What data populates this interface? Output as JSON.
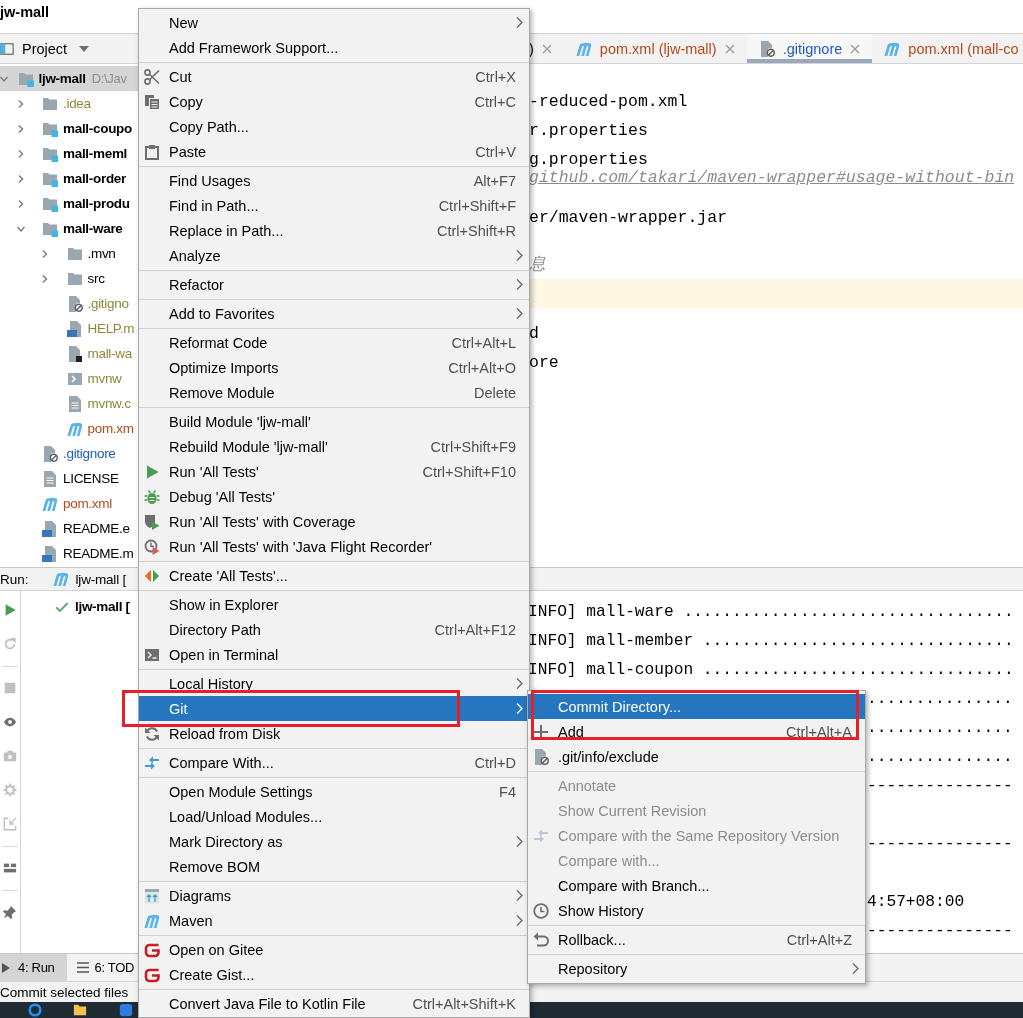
{
  "title_bar": {
    "title": "jw-mall"
  },
  "project_panel": {
    "title": "Project",
    "tree": [
      {
        "label": "ljw-mall",
        "path": "D:\\Jav",
        "kind": "module",
        "color": "#000000",
        "selected": true,
        "expanded": true,
        "children": [
          {
            "label": ".idea",
            "kind": "folder",
            "color": "#8c8a3a",
            "selected": false,
            "expanded": false
          },
          {
            "label": "mall-coupo",
            "kind": "module",
            "color": "#000000",
            "selected": false,
            "expanded": false
          },
          {
            "label": "mall-meml",
            "kind": "module",
            "color": "#000000",
            "selected": false,
            "expanded": false
          },
          {
            "label": "mall-order",
            "kind": "module",
            "color": "#000000",
            "selected": false,
            "expanded": false
          },
          {
            "label": "mall-produ",
            "kind": "module",
            "color": "#000000",
            "selected": false,
            "expanded": false
          },
          {
            "label": "mall-ware",
            "kind": "module",
            "color": "#000000",
            "selected": false,
            "expanded": true,
            "children": [
              {
                "label": ".mvn",
                "kind": "folder",
                "color": "#000000",
                "selected": false,
                "expanded": false
              },
              {
                "label": "src",
                "kind": "folder",
                "color": "#000000",
                "selected": false,
                "expanded": false
              },
              {
                "label": ".gitigno",
                "kind": "ignore",
                "color": "#8c8a3a",
                "selected": false
              },
              {
                "label": "HELP.m",
                "kind": "md",
                "color": "#8c8a3a",
                "selected": false
              },
              {
                "label": "mall-wa",
                "kind": "iml",
                "color": "#8c8a3a",
                "selected": false
              },
              {
                "label": "mvnw",
                "kind": "script",
                "color": "#8c8a3a",
                "selected": false
              },
              {
                "label": "mvnw.c",
                "kind": "text",
                "color": "#8c8a3a",
                "selected": false
              },
              {
                "label": "pom.xm",
                "kind": "maven",
                "color": "#b5491c",
                "selected": false
              }
            ]
          },
          {
            "label": ".gitignore",
            "kind": "ignore",
            "color": "#1d5bbf",
            "selected": false
          },
          {
            "label": "LICENSE",
            "kind": "text",
            "color": "#000000",
            "selected": false
          },
          {
            "label": "pom.xml",
            "kind": "maven",
            "color": "#b5491c",
            "selected": false
          },
          {
            "label": "README.e",
            "kind": "md",
            "color": "#000000",
            "selected": false
          },
          {
            "label": "README.m",
            "kind": "md",
            "color": "#000000",
            "selected": false
          }
        ]
      }
    ]
  },
  "editor": {
    "tabs": [
      {
        "label": ")",
        "kind": "plain",
        "selected": false
      },
      {
        "label": "pom.xml (ljw-mall)",
        "kind": "maven",
        "color": "#b5491c",
        "selected": false
      },
      {
        "label": ".gitignore",
        "kind": "ignore",
        "color": "#1d5bbf",
        "selected": true
      },
      {
        "label": "pom.xml (mall-co",
        "kind": "maven",
        "color": "#b5491c",
        "selected": false
      }
    ],
    "lines": [
      {
        "text": "-reduced-pom.xml",
        "kind": "code",
        "current": false
      },
      {
        "text": "r.properties",
        "kind": "code",
        "current": false
      },
      {
        "text": "g.properties",
        "kind": "code",
        "current": false
      },
      {
        "text": "github.com/takari/maven-wrapper#usage-without-bin",
        "kind": "link",
        "current": false
      },
      {
        "text": "er/maven-wrapper.jar",
        "kind": "code",
        "current": false
      },
      {
        "kind": "blank",
        "current": false
      },
      {
        "text": "息",
        "kind": "comment",
        "current": false
      },
      {
        "kind": "blank",
        "current": true
      },
      {
        "text": "d",
        "kind": "code",
        "current": false
      },
      {
        "text": "ore",
        "kind": "code",
        "current": false
      }
    ]
  },
  "run_panel": {
    "title": "Run:",
    "tab": {
      "label": "ljw-mall [",
      "kind": "maven"
    },
    "toolbar": [
      {
        "buttons": [
          {
            "kind": "run",
            "disabled": false
          },
          {
            "kind": "rerun",
            "disabled": true
          }
        ]
      },
      {
        "buttons": [
          {
            "kind": "stop",
            "disabled": true
          },
          {
            "kind": "eye",
            "disabled": false
          },
          {
            "kind": "camera",
            "disabled": true
          },
          {
            "kind": "export",
            "disabled": true
          },
          {
            "kind": "import",
            "disabled": true
          }
        ]
      },
      {
        "buttons": [
          {
            "kind": "layout",
            "disabled": false
          }
        ]
      },
      {
        "buttons": [
          {
            "kind": "pin",
            "disabled": false
          }
        ]
      }
    ],
    "tree": [
      {
        "label": "ljw-mall [",
        "passed": true
      }
    ],
    "console": [
      {
        "text": "INFO] mall-ware ..................................",
        "kind": "full"
      },
      {
        "text": "INFO] mall-member ................................",
        "kind": "full"
      },
      {
        "text": "INFO] mall-coupon ................................",
        "kind": "full"
      },
      {
        "text": "...............",
        "kind": "tail"
      },
      {
        "text": "...............",
        "kind": "tail"
      },
      {
        "text": "...............",
        "kind": "tail"
      },
      {
        "text": "---------------",
        "kind": "tail"
      },
      {
        "kind": "blank"
      },
      {
        "text": "---------------",
        "kind": "tail"
      },
      {
        "kind": "blank"
      },
      {
        "text": "4:57+08:00",
        "kind": "tail"
      },
      {
        "text": "---------------",
        "kind": "tail"
      }
    ]
  },
  "tool_window_bar": {
    "tabs": [
      {
        "label": "4: Run",
        "kind": "run",
        "selected": true
      },
      {
        "label": "6: TOD",
        "kind": "todo",
        "selected": false
      }
    ]
  },
  "status_bar": {
    "text": "Commit selected files"
  },
  "context_menu": {
    "groups": [
      {
        "items": [
          {
            "label": "New",
            "kind": "plain",
            "submenu": true,
            "selected": false,
            "boxed": false
          },
          {
            "label": "Add Framework Support...",
            "kind": "plain",
            "submenu": false,
            "selected": false,
            "boxed": false
          }
        ]
      },
      {
        "items": [
          {
            "label": "Cut",
            "shortcut": "Ctrl+X",
            "kind": "cut",
            "submenu": false,
            "selected": false,
            "boxed": false
          },
          {
            "label": "Copy",
            "shortcut": "Ctrl+C",
            "kind": "copy",
            "submenu": false,
            "selected": false,
            "boxed": false
          },
          {
            "label": "Copy Path...",
            "kind": "plain",
            "submenu": false,
            "selected": false,
            "boxed": false
          },
          {
            "label": "Paste",
            "shortcut": "Ctrl+V",
            "kind": "paste",
            "submenu": false,
            "selected": false,
            "boxed": false
          }
        ]
      },
      {
        "items": [
          {
            "label": "Find Usages",
            "shortcut": "Alt+F7",
            "kind": "plain",
            "submenu": false,
            "selected": false,
            "boxed": false
          },
          {
            "label": "Find in Path...",
            "shortcut": "Ctrl+Shift+F",
            "kind": "plain",
            "submenu": false,
            "selected": false,
            "boxed": false
          },
          {
            "label": "Replace in Path...",
            "shortcut": "Ctrl+Shift+R",
            "kind": "plain",
            "submenu": false,
            "selected": false,
            "boxed": false
          },
          {
            "label": "Analyze",
            "kind": "plain",
            "submenu": true,
            "selected": false,
            "boxed": false
          }
        ]
      },
      {
        "items": [
          {
            "label": "Refactor",
            "kind": "plain",
            "submenu": true,
            "selected": false,
            "boxed": false
          }
        ]
      },
      {
        "items": [
          {
            "label": "Add to Favorites",
            "kind": "plain",
            "submenu": true,
            "selected": false,
            "boxed": false
          }
        ]
      },
      {
        "items": [
          {
            "label": "Reformat Code",
            "shortcut": "Ctrl+Alt+L",
            "kind": "plain",
            "submenu": false,
            "selected": false,
            "boxed": false
          },
          {
            "label": "Optimize Imports",
            "shortcut": "Ctrl+Alt+O",
            "kind": "plain",
            "submenu": false,
            "selected": false,
            "boxed": false
          },
          {
            "label": "Remove Module",
            "shortcut": "Delete",
            "kind": "plain",
            "submenu": false,
            "selected": false,
            "boxed": false
          }
        ]
      },
      {
        "items": [
          {
            "label": "Build Module 'ljw-mall'",
            "kind": "plain",
            "submenu": false,
            "selected": false,
            "boxed": false
          },
          {
            "label": "Rebuild Module 'ljw-mall'",
            "shortcut": "Ctrl+Shift+F9",
            "kind": "plain",
            "submenu": false,
            "selected": false,
            "boxed": false
          },
          {
            "label": "Run 'All Tests'",
            "shortcut": "Ctrl+Shift+F10",
            "kind": "run",
            "submenu": false,
            "selected": false,
            "boxed": false
          },
          {
            "label": "Debug 'All Tests'",
            "kind": "debug",
            "submenu": false,
            "selected": false,
            "boxed": false
          },
          {
            "label": "Run 'All Tests' with Coverage",
            "kind": "coverage",
            "submenu": false,
            "selected": false,
            "boxed": false
          },
          {
            "label": "Run 'All Tests' with 'Java Flight Recorder'",
            "kind": "profiler",
            "submenu": false,
            "selected": false,
            "boxed": false
          }
        ]
      },
      {
        "items": [
          {
            "label": "Create 'All Tests'...",
            "kind": "create-test",
            "submenu": false,
            "selected": false,
            "boxed": false
          }
        ]
      },
      {
        "items": [
          {
            "label": "Show in Explorer",
            "kind": "plain",
            "submenu": false,
            "selected": false,
            "boxed": false
          },
          {
            "label": "Directory Path",
            "shortcut": "Ctrl+Alt+F12",
            "kind": "plain",
            "submenu": false,
            "selected": false,
            "boxed": false
          },
          {
            "label": "Open in Terminal",
            "kind": "terminal",
            "submenu": false,
            "selected": false,
            "boxed": false
          }
        ]
      },
      {
        "items": [
          {
            "label": "Local History",
            "kind": "plain",
            "submenu": true,
            "selected": false,
            "boxed": false
          },
          {
            "label": "Git",
            "kind": "plain",
            "submenu": true,
            "selected": true,
            "boxed": true
          },
          {
            "label": "Reload from Disk",
            "kind": "reload",
            "submenu": false,
            "selected": false,
            "boxed": false
          }
        ]
      },
      {
        "items": [
          {
            "label": "Compare With...",
            "shortcut": "Ctrl+D",
            "kind": "compare",
            "submenu": false,
            "selected": false,
            "boxed": false
          }
        ]
      },
      {
        "items": [
          {
            "label": "Open Module Settings",
            "shortcut": "F4",
            "kind": "plain",
            "submenu": false,
            "selected": false,
            "boxed": false
          },
          {
            "label": "Load/Unload Modules...",
            "kind": "plain",
            "submenu": false,
            "selected": false,
            "boxed": false
          },
          {
            "label": "Mark Directory as",
            "kind": "plain",
            "submenu": true,
            "selected": false,
            "boxed": false
          },
          {
            "label": "Remove BOM",
            "kind": "plain",
            "submenu": false,
            "selected": false,
            "boxed": false
          }
        ]
      },
      {
        "items": [
          {
            "label": "Diagrams",
            "kind": "diagram",
            "submenu": true,
            "selected": false,
            "boxed": false
          },
          {
            "label": "Maven",
            "kind": "maven",
            "submenu": true,
            "selected": false,
            "boxed": false
          }
        ]
      },
      {
        "items": [
          {
            "label": "Open on Gitee",
            "kind": "gitee",
            "submenu": false,
            "selected": false,
            "boxed": false
          },
          {
            "label": "Create Gist...",
            "kind": "gitee",
            "submenu": false,
            "selected": false,
            "boxed": false
          }
        ]
      },
      {
        "items": [
          {
            "label": "Convert Java File to Kotlin File",
            "shortcut": "Ctrl+Alt+Shift+K",
            "kind": "plain",
            "submenu": false,
            "selected": false,
            "boxed": false
          }
        ]
      }
    ]
  },
  "git_submenu": {
    "groups": [
      {
        "items": [
          {
            "label": "Commit Directory...",
            "kind": "plain",
            "submenu": false,
            "selected": true,
            "boxed": true,
            "disabled": false
          },
          {
            "label": "Add",
            "shortcut": "Ctrl+Alt+A",
            "kind": "add",
            "submenu": false,
            "selected": false,
            "boxed": true,
            "disabled": false
          },
          {
            "label": ".git/info/exclude",
            "kind": "ignore",
            "submenu": false,
            "selected": false,
            "boxed": false,
            "disabled": false
          }
        ]
      },
      {
        "items": [
          {
            "label": "Annotate",
            "kind": "plain",
            "submenu": false,
            "selected": false,
            "boxed": false,
            "disabled": true
          },
          {
            "label": "Show Current Revision",
            "kind": "plain",
            "submenu": false,
            "selected": false,
            "boxed": false,
            "disabled": true
          },
          {
            "label": "Compare with the Same Repository Version",
            "kind": "compare",
            "submenu": false,
            "selected": false,
            "boxed": false,
            "disabled": true
          },
          {
            "label": "Compare with...",
            "kind": "plain",
            "submenu": false,
            "selected": false,
            "boxed": false,
            "disabled": true
          },
          {
            "label": "Compare with Branch...",
            "kind": "plain",
            "submenu": false,
            "selected": false,
            "boxed": false,
            "disabled": false
          },
          {
            "label": "Show History",
            "kind": "history",
            "submenu": false,
            "selected": false,
            "boxed": false,
            "disabled": false
          }
        ]
      },
      {
        "items": [
          {
            "label": "Rollback...",
            "shortcut": "Ctrl+Alt+Z",
            "kind": "rollback",
            "submenu": false,
            "selected": false,
            "boxed": false,
            "disabled": false
          }
        ]
      },
      {
        "items": [
          {
            "label": "Repository",
            "kind": "plain",
            "submenu": true,
            "selected": false,
            "boxed": false,
            "disabled": false
          }
        ]
      }
    ]
  }
}
